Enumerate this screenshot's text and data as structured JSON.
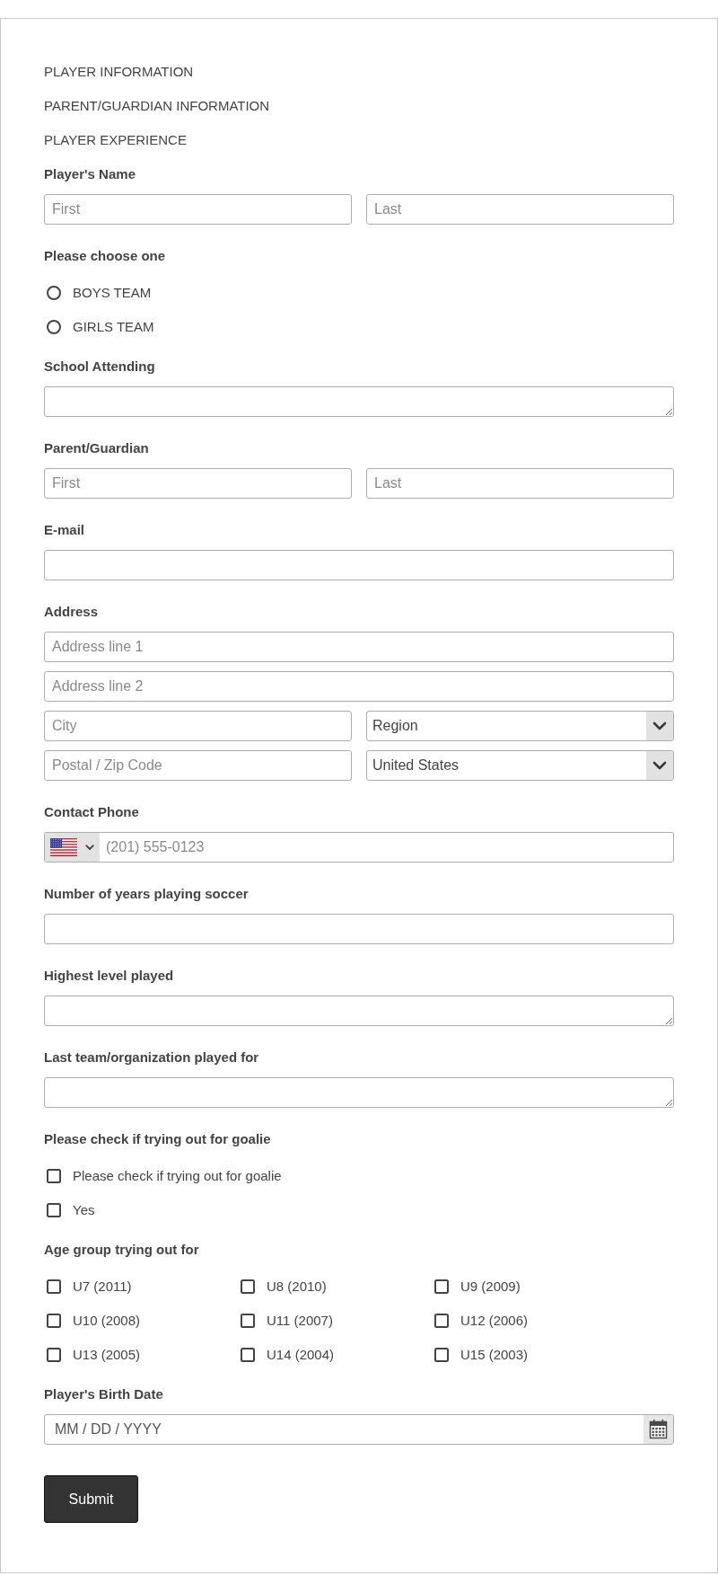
{
  "sections": [
    "PLAYER INFORMATION",
    "PARENT/GUARDIAN INFORMATION",
    "PLAYER EXPERIENCE"
  ],
  "fields": [
    {
      "kind": "name",
      "label": "Player's Name",
      "inputs": [
        {
          "placeholder": "First"
        },
        {
          "placeholder": "Last"
        }
      ]
    },
    {
      "kind": "radio",
      "label": "Please choose one",
      "options": [
        {
          "label": "BOYS TEAM",
          "selected": false
        },
        {
          "label": "GIRLS TEAM",
          "selected": false
        }
      ]
    },
    {
      "kind": "textarea",
      "label": "School Attending"
    },
    {
      "kind": "name",
      "label": "Parent/Guardian",
      "inputs": [
        {
          "placeholder": "First"
        },
        {
          "placeholder": "Last"
        }
      ]
    },
    {
      "kind": "text",
      "label": "E-mail"
    },
    {
      "kind": "address",
      "label": "Address",
      "rows": [
        {
          "inputs": [
            {
              "kind": "text",
              "placeholder": "Address line 1"
            }
          ]
        },
        {
          "inputs": [
            {
              "kind": "text",
              "placeholder": "Address line 2"
            }
          ]
        },
        {
          "inputs": [
            {
              "kind": "text",
              "placeholder": "City"
            },
            {
              "kind": "select",
              "value": "Region"
            }
          ]
        },
        {
          "inputs": [
            {
              "kind": "text",
              "placeholder": "Postal / Zip Code"
            },
            {
              "kind": "select",
              "value": "United States"
            }
          ]
        }
      ]
    },
    {
      "kind": "phone",
      "label": "Contact Phone",
      "placeholder": "(201) 555-0123"
    },
    {
      "kind": "text",
      "label": "Number of years playing soccer"
    },
    {
      "kind": "textarea",
      "label": "Highest level played"
    },
    {
      "kind": "textarea",
      "label": "Last team/organization played for"
    },
    {
      "kind": "checkbox",
      "label": "Please check if trying out for goalie",
      "options": [
        {
          "label": "Please check if trying out for goalie",
          "checked": false
        },
        {
          "label": "Yes",
          "checked": false
        }
      ]
    },
    {
      "kind": "checkgrid",
      "label": "Age group trying out for",
      "options": [
        {
          "label": "U7 (2011)",
          "checked": false
        },
        {
          "label": "U8 (2010)",
          "checked": false
        },
        {
          "label": "U9 (2009)",
          "checked": false
        },
        {
          "label": "U10 (2008)",
          "checked": false
        },
        {
          "label": "U11 (2007)",
          "checked": false
        },
        {
          "label": "U12 (2006)",
          "checked": false
        },
        {
          "label": "U13 (2005)",
          "checked": false
        },
        {
          "label": "U14 (2004)",
          "checked": false
        },
        {
          "label": "U15 (2003)",
          "checked": false
        }
      ]
    },
    {
      "kind": "date",
      "label": "Player's Birth Date",
      "placeholder": "MM / DD / YYYY"
    }
  ],
  "submit": "Submit"
}
